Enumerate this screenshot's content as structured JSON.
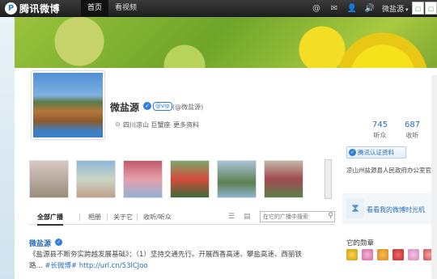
{
  "topbar": {
    "logo_mark": "P",
    "brand": "腾讯微博",
    "nav": [
      {
        "label": "首页"
      },
      {
        "label": "看视频"
      }
    ],
    "tools": [
      "@",
      "✉",
      "👤",
      "🔊"
    ],
    "user": "微盐源"
  },
  "profile": {
    "name": "微盐源",
    "vip_label": "@vip",
    "handle": "(@微盐源)",
    "location": "四川凉山 巨蟹座",
    "more": "更多资料",
    "listeners": {
      "value": "745",
      "label": "听众"
    },
    "listening": {
      "value": "687",
      "label": "收听"
    }
  },
  "tabs": {
    "items": [
      "全部广播",
      "相册",
      "关于它",
      "收听/听众"
    ],
    "search_placeholder": "在它的广播中搜索"
  },
  "post": {
    "author": "微盐源",
    "text_1": "《盐源县不断夯实跨越发展基础》：（1）坚持交通先行。开展西香高速、攀盐高速、西丽铁",
    "text_2_prefix": "路...",
    "text_2_tag": "#长微博#",
    "text_2_link": "http://url.cn/53lCJoo"
  },
  "right": {
    "cert_label": "腾讯认证资料",
    "cert_desc": "凉山州盐源县人民政府办公室官方",
    "timeline_link": "看看我的微博时光机",
    "medals_title": "它的勋章"
  }
}
